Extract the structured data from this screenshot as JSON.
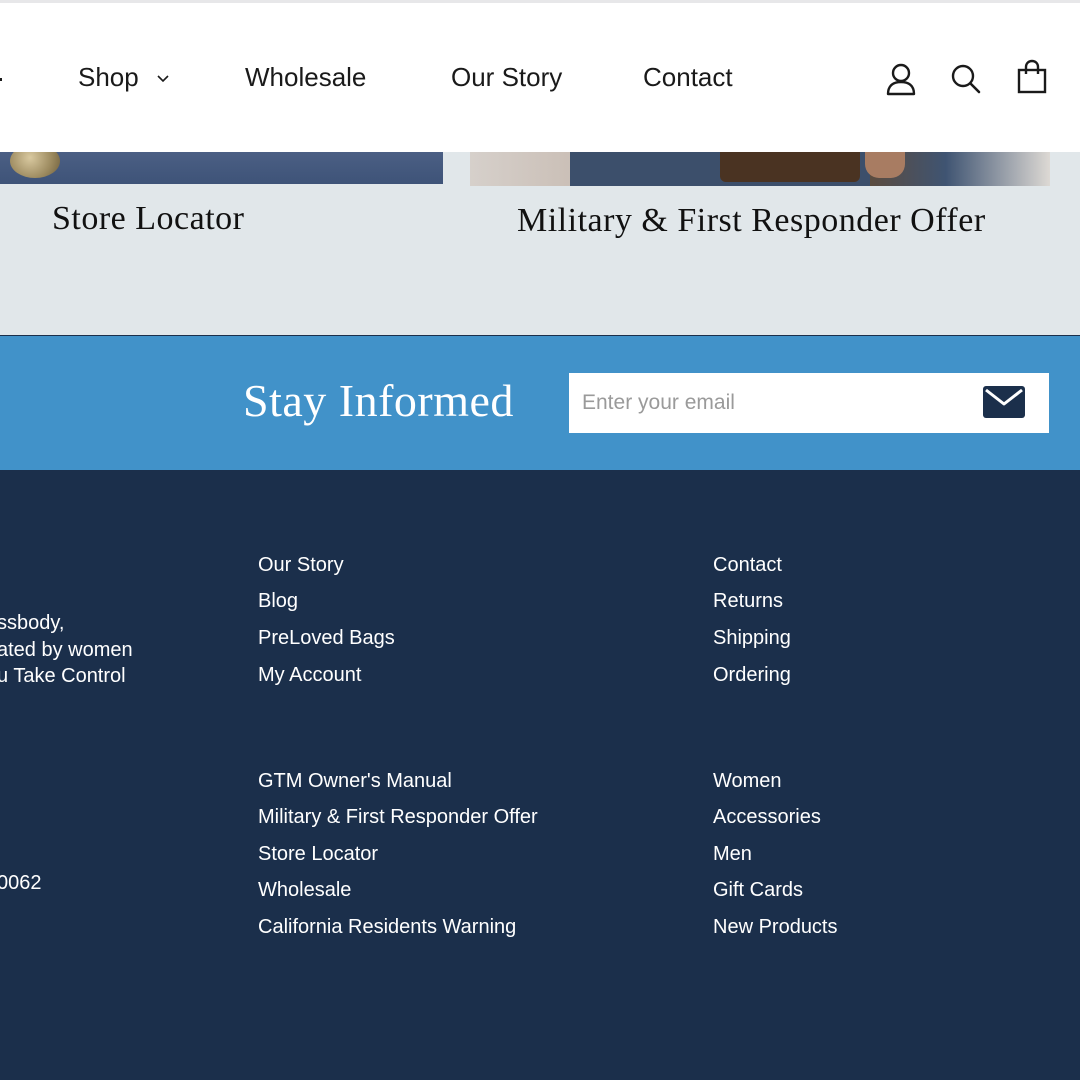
{
  "nav": {
    "items": [
      {
        "label": "Shop"
      },
      {
        "label": "Wholesale"
      },
      {
        "label": "Our Story"
      },
      {
        "label": "Contact"
      }
    ],
    "icons": [
      "user-icon",
      "search-icon",
      "cart-icon"
    ]
  },
  "cards": [
    {
      "title": "Store Locator"
    },
    {
      "title": "Military & First Responder Offer"
    }
  ],
  "newsletter": {
    "title": "Stay Informed",
    "placeholder": "Enter your email",
    "submit_icon": "envelope-icon"
  },
  "footer": {
    "about_lines": [
      "ssbody,",
      "ated by women",
      "u Take Control"
    ],
    "phone_partial": "0062",
    "col1_top": [
      "Our Story",
      "Blog",
      "PreLoved Bags",
      "My Account"
    ],
    "col2_top": [
      "Contact",
      "Returns",
      "Shipping",
      "Ordering"
    ],
    "col1_bottom": [
      "GTM Owner's Manual",
      "Military & First Responder Offer",
      "Store Locator",
      "Wholesale",
      "California Residents Warning"
    ],
    "col2_bottom": [
      "Women",
      "Accessories",
      "Men",
      "Gift Cards",
      "New Products"
    ]
  },
  "colors": {
    "header_bg": "#ffffff",
    "cards_bg": "#e1e7ea",
    "newsletter_bg": "#4192c9",
    "footer_bg": "#1b2f4b",
    "envelope": "#1b2f4b"
  }
}
